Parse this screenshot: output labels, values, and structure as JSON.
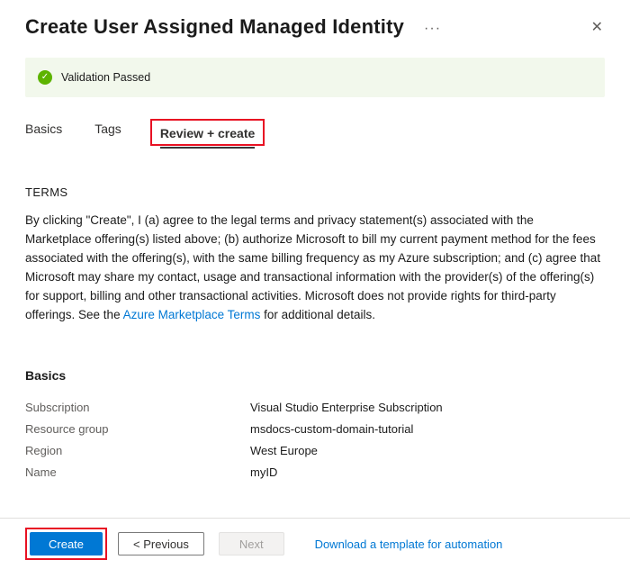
{
  "header": {
    "title": "Create User Assigned Managed Identity",
    "more_icon": "···",
    "close_icon": "✕"
  },
  "banner": {
    "text": "Validation Passed"
  },
  "tabs": [
    {
      "label": "Basics",
      "active": false
    },
    {
      "label": "Tags",
      "active": false
    },
    {
      "label": "Review + create",
      "active": true
    }
  ],
  "terms": {
    "heading": "TERMS",
    "body_before_link": "By clicking \"Create\", I (a) agree to the legal terms and privacy statement(s) associated with the Marketplace offering(s) listed above; (b) authorize Microsoft to bill my current payment method for the fees associated with the offering(s), with the same billing frequency as my Azure subscription; and (c) agree that Microsoft may share my contact, usage and transactional information with the provider(s) of the offering(s) for support, billing and other transactional activities. Microsoft does not provide rights for third-party offerings. See the ",
    "link_text": "Azure Marketplace Terms",
    "body_after_link": " for additional details."
  },
  "basics": {
    "heading": "Basics",
    "rows": [
      {
        "label": "Subscription",
        "value": "Visual Studio Enterprise Subscription"
      },
      {
        "label": "Resource group",
        "value": "msdocs-custom-domain-tutorial"
      },
      {
        "label": "Region",
        "value": "West Europe"
      },
      {
        "label": "Name",
        "value": "myID"
      }
    ]
  },
  "footer": {
    "create_label": "Create",
    "previous_label": "< Previous",
    "next_label": "Next",
    "download_link": "Download a template for automation"
  },
  "icons": {
    "success_check": "✓"
  },
  "colors": {
    "accent": "#0078d4",
    "success_green": "#5db300",
    "success_banner_bg": "#f2f8ec",
    "callout_red": "#e81123",
    "text_primary": "#1b1b1b",
    "text_secondary": "#605e5c"
  }
}
